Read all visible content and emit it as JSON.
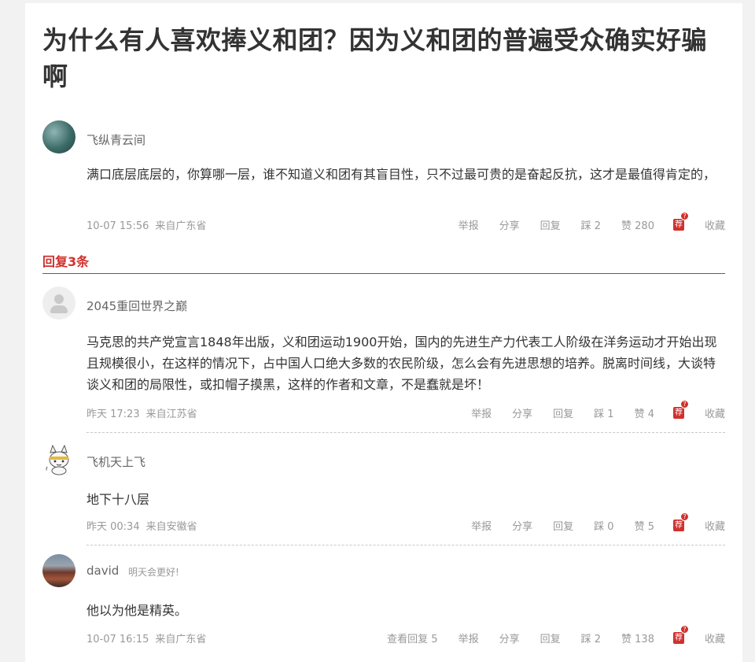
{
  "article": {
    "title": "为什么有人喜欢捧义和团？因为义和团的普遍受众确实好骗啊"
  },
  "main_comment": {
    "user": "飞纵青云间",
    "content": "满口底层底层的，你算哪一层，谁不知道义和团有其盲目性，只不过最可贵的是奋起反抗，这才是最值得肯定的，",
    "time": "10-07 15:56",
    "location": "来自广东省",
    "report": "举报",
    "share": "分享",
    "reply": "回复",
    "dislike": "踩 2",
    "like": "赞 280",
    "recommend_badge": "荐",
    "recommend_q": "?",
    "favorite": "收藏"
  },
  "replies_header": "回复3条",
  "replies": [
    {
      "user": "2045重回世界之巅",
      "content": "马克思的共产党宣言1848年出版，义和团运动1900开始，国内的先进生产力代表工人阶级在洋务运动才开始出现且规模很小，在这样的情况下，占中国人口绝大多数的农民阶级，怎么会有先进思想的培养。脱离时间线，大谈特谈义和团的局限性，或扣帽子摸黑，这样的作者和文章，不是蠢就是坏！",
      "time": "昨天 17:23",
      "location": "来自江苏省",
      "report": "举报",
      "share": "分享",
      "reply": "回复",
      "dislike": "踩 1",
      "like": "赞 4",
      "recommend_badge": "荐",
      "recommend_q": "?",
      "favorite": "收藏"
    },
    {
      "user": "飞机天上飞",
      "content": "地下十八层",
      "time": "昨天 00:34",
      "location": "来自安徽省",
      "report": "举报",
      "share": "分享",
      "reply": "回复",
      "dislike": "踩 0",
      "like": "赞 5",
      "recommend_badge": "荐",
      "recommend_q": "?",
      "favorite": "收藏"
    },
    {
      "user": "david",
      "signature": "明天会更好!",
      "content": "他以为他是精英。",
      "time": "10-07 16:15",
      "location": "来自广东省",
      "view_replies": "查看回复 5",
      "report": "举报",
      "share": "分享",
      "reply": "回复",
      "dislike": "踩 2",
      "like": "赞 138",
      "recommend_badge": "荐",
      "recommend_q": "?",
      "favorite": "收藏"
    }
  ],
  "colors": {
    "accent": "#d0312d",
    "text": "#333333",
    "meta": "#999999",
    "background": "#f2f2f2"
  }
}
